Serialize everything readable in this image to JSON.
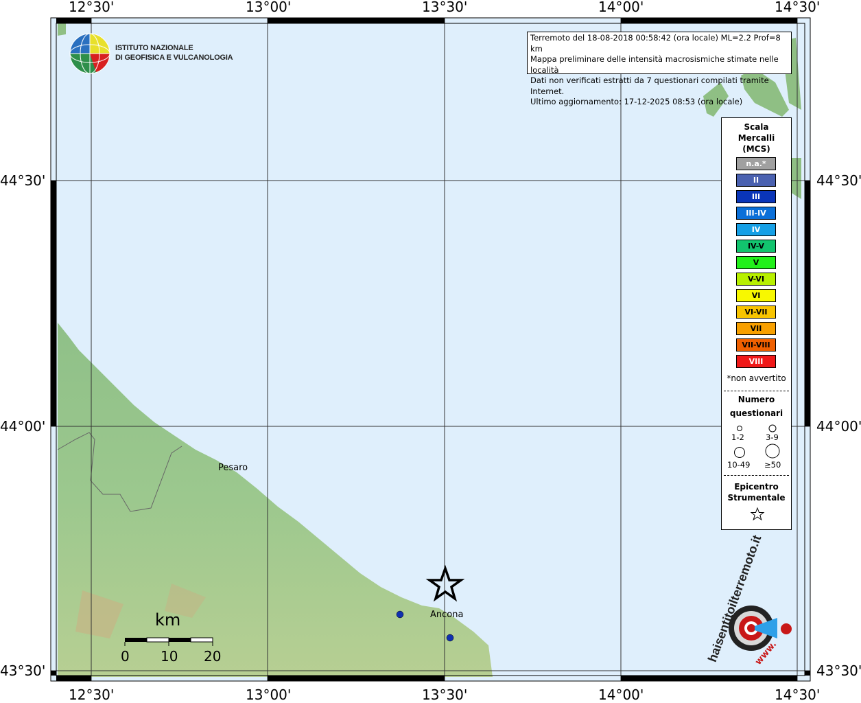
{
  "map": {
    "lon_labels": [
      "12°30'",
      "13°00'",
      "13°30'",
      "14°00'",
      "14°30'"
    ],
    "lat_labels": [
      "44°30'",
      "44°00'",
      "43°30'"
    ],
    "cities": [
      {
        "name": "Pesaro"
      },
      {
        "name": "Ancona"
      }
    ],
    "scale_bar": {
      "unit": "km",
      "ticks": [
        "0",
        "10",
        "20"
      ]
    }
  },
  "logo": {
    "line1": "ISTITUTO NAZIONALE",
    "line2": "DI GEOFISICA E VULCANOLOGIA"
  },
  "info": {
    "line1": "Terremoto del 18-08-2018 00:58:42 (ora locale) ML=2.2 Prof=8 km",
    "line2": "Mappa preliminare delle intensità macrosismiche stimate nelle località",
    "line3": "Dati non verificati estratti da 7 questionari compilati tramite Internet.",
    "line4": "Ultimo aggiornamento: 17-12-2025 08:53 (ora locale)"
  },
  "legend": {
    "title1": "Scala",
    "title2": "Mercalli",
    "title3": "(MCS)",
    "levels": [
      {
        "label": "n.a.*",
        "color": "#a0a0a0",
        "text": "#ffffff"
      },
      {
        "label": "II",
        "color": "#4a61b0",
        "text": "#ffffff"
      },
      {
        "label": "III",
        "color": "#0a35b8",
        "text": "#ffffff"
      },
      {
        "label": "III-IV",
        "color": "#0a6fd8",
        "text": "#ffffff"
      },
      {
        "label": "IV",
        "color": "#16a0e6",
        "text": "#ffffff"
      },
      {
        "label": "IV-V",
        "color": "#12c46e",
        "text": "#000000"
      },
      {
        "label": "V",
        "color": "#22f01a",
        "text": "#000000"
      },
      {
        "label": "V-VI",
        "color": "#b8f000",
        "text": "#000000"
      },
      {
        "label": "VI",
        "color": "#f8f800",
        "text": "#000000"
      },
      {
        "label": "VI-VII",
        "color": "#f8c400",
        "text": "#000000"
      },
      {
        "label": "VII",
        "color": "#f8a000",
        "text": "#000000"
      },
      {
        "label": "VII-VIII",
        "color": "#f06000",
        "text": "#000000"
      },
      {
        "label": "VIII",
        "color": "#f01818",
        "text": "#ffffff"
      }
    ],
    "note": "*non avvertito",
    "count_title1": "Numero",
    "count_title2": "questionari",
    "count_labels": [
      "1-2",
      "3-9",
      "10-49",
      "≥50"
    ],
    "epi_title1": "Epicentro",
    "epi_title2": "Strumentale"
  },
  "badge": {
    "text": "haisentitoilterremoto.it",
    "url_text": "www."
  },
  "colors": {
    "sea": "#dfeffc",
    "land": "#8fbf84",
    "point": "#1030b0"
  }
}
